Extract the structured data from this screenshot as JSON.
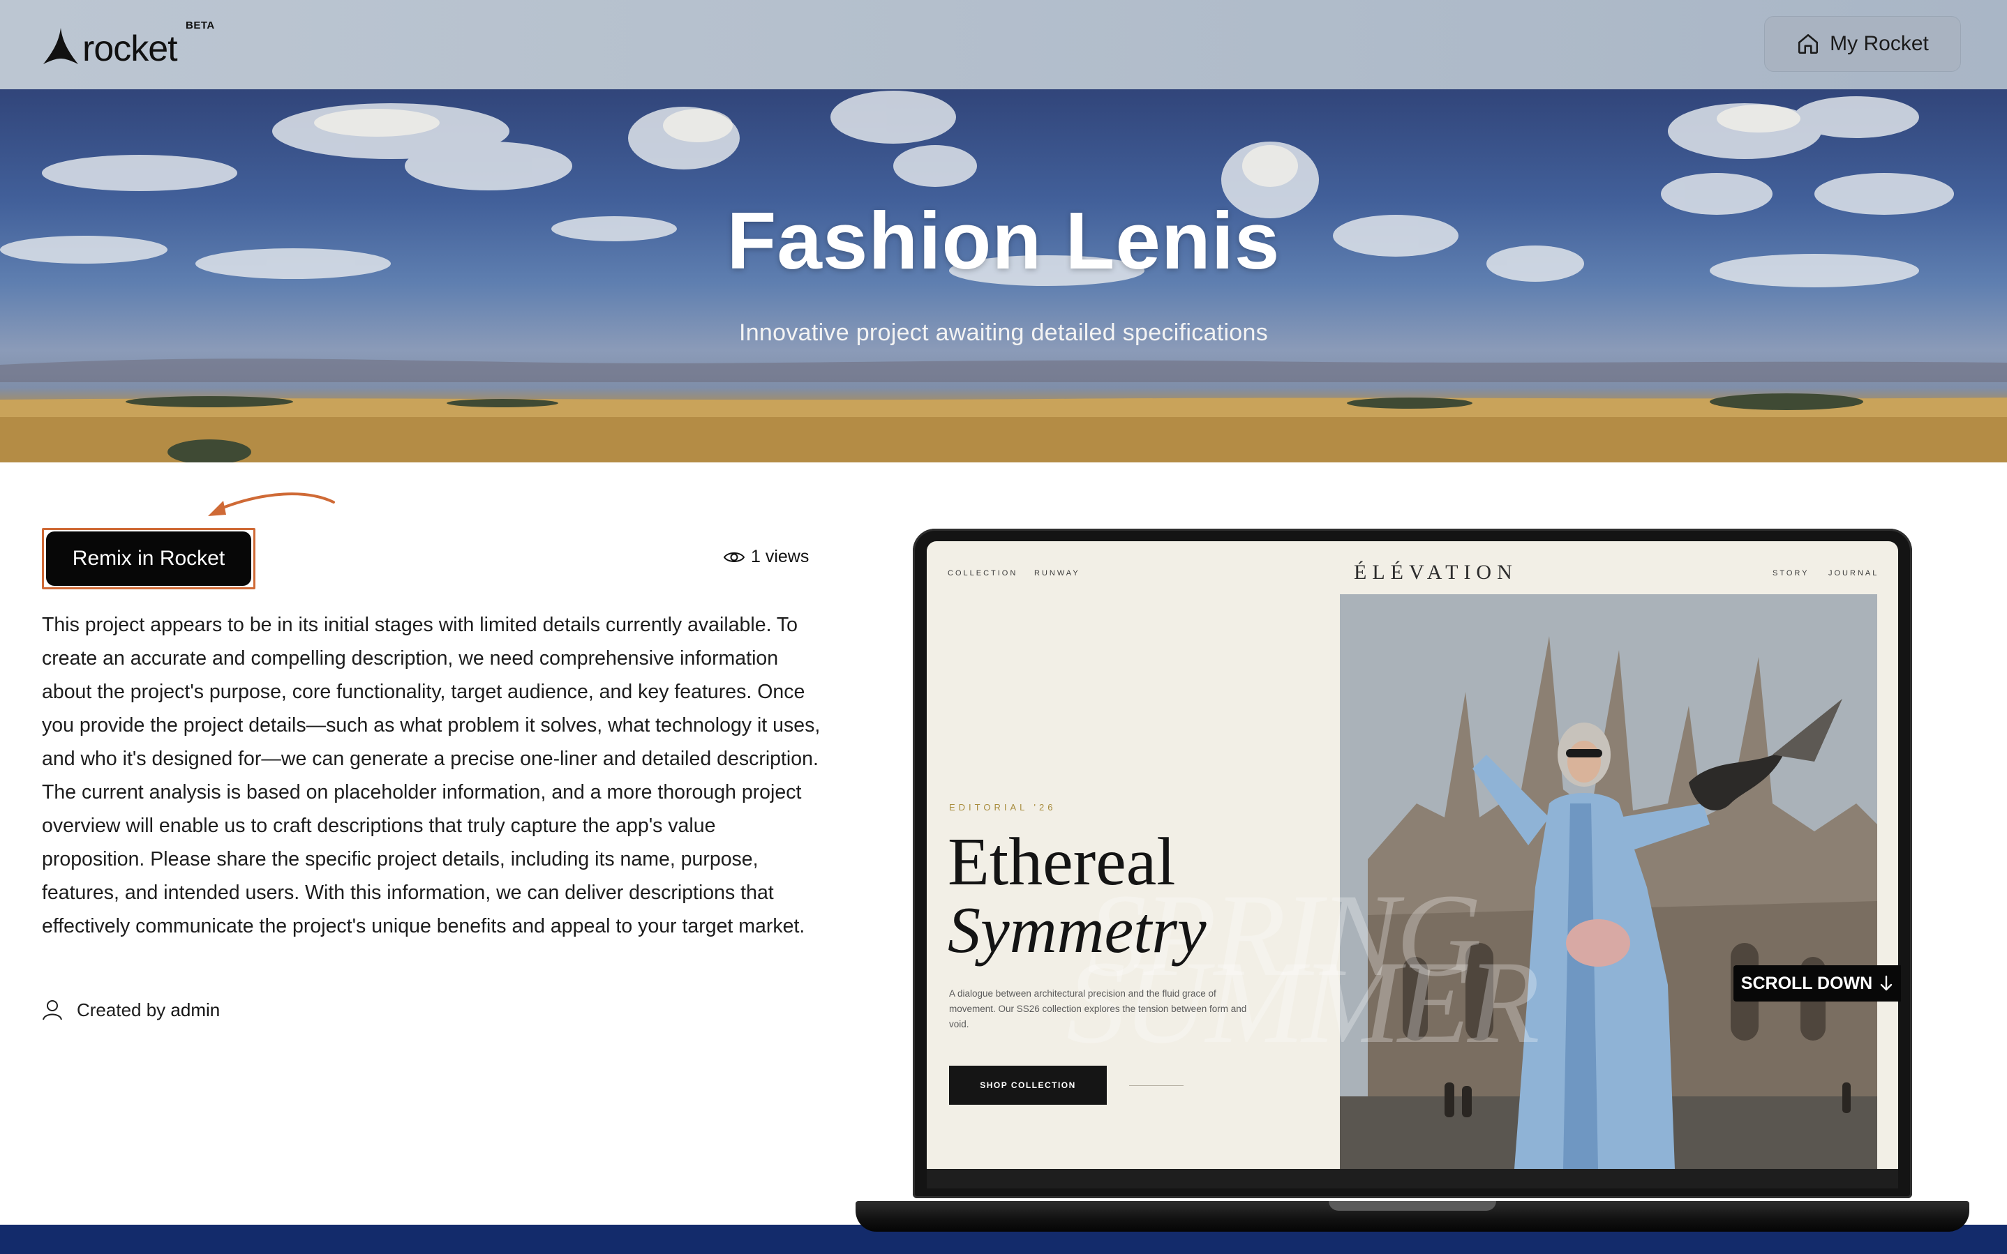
{
  "header": {
    "logo_text": "rocket",
    "beta_label": "BETA",
    "my_rocket_label": "My Rocket"
  },
  "hero": {
    "title": "Fashion Lenis",
    "subtitle": "Innovative project awaiting detailed specifications"
  },
  "project": {
    "remix_label": "Remix in Rocket",
    "views_label": "1 views",
    "description": "This project appears to be in its initial stages with limited details currently available. To create an accurate and compelling description, we need comprehensive information about the project's purpose, core functionality, target audience, and key features. Once you provide the project details—such as what problem it solves, what technology it uses, and who it's designed for—we can generate a precise one-liner and detailed description. The current analysis is based on placeholder information, and a more thorough project overview will enable us to craft descriptions that truly capture the app's value proposition. Please share the specific project details, including its name, purpose, features, and intended users. With this information, we can deliver descriptions that effectively communicate the project's unique benefits and appeal to your target market.",
    "created_prefix": "Created by",
    "created_by": "admin"
  },
  "preview": {
    "nav_left": [
      "COLLECTION",
      "RUNWAY"
    ],
    "brand": "ÉLÉVATION",
    "nav_right": [
      "STORY",
      "JOURNAL"
    ],
    "eyebrow": "EDITORIAL '26",
    "headline_1": "Ethereal",
    "headline_2": "Symmetry",
    "ghost_1": "SPRING",
    "ghost_2": "SUMMER",
    "paragraph": "A dialogue between architectural precision and the fluid grace of movement. Our SS26 collection explores the tension between form and void.",
    "shop_label": "SHOP COLLECTION",
    "scroll_label": "SCROLL DOWN"
  },
  "colors": {
    "accent_orange": "#cf6a36",
    "button_black": "#070707",
    "band_navy": "#132b6b"
  },
  "icons": {
    "logo": "rocket-mark-icon",
    "my_rocket": "home-icon",
    "views": "eye-icon",
    "creator": "user-icon",
    "scroll": "arrow-down-icon"
  }
}
